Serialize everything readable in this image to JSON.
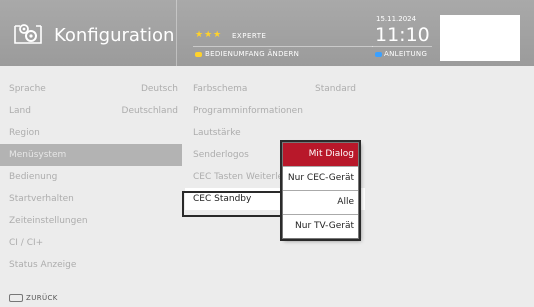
{
  "header": {
    "title": "Konfiguration",
    "stars": "★★★",
    "level": "Experte",
    "action_change": "Bedienumfang ändern",
    "date": "15.11.2024",
    "time": "11:10",
    "action_help": "Anleitung"
  },
  "menu": {
    "items": [
      {
        "label": "Sprache",
        "value": "Deutsch"
      },
      {
        "label": "Land",
        "value": "Deutschland"
      },
      {
        "label": "Region",
        "value": ""
      },
      {
        "label": "Menüsystem",
        "value": ""
      },
      {
        "label": "Bedienung",
        "value": ""
      },
      {
        "label": "Startverhalten",
        "value": ""
      },
      {
        "label": "Zeiteinstellungen",
        "value": ""
      },
      {
        "label": "CI / CI+",
        "value": ""
      },
      {
        "label": "Status Anzeige",
        "value": ""
      }
    ],
    "active_index": 3
  },
  "submenu": {
    "items": [
      {
        "label": "Farbschema",
        "value": "Standard"
      },
      {
        "label": "Programminformationen",
        "value": ""
      },
      {
        "label": "Lautstärke",
        "value": ""
      },
      {
        "label": "Senderlogos",
        "value": ""
      },
      {
        "label": "CEC Tasten Weiterle",
        "value": ""
      },
      {
        "label": "CEC Standby",
        "value": ""
      }
    ],
    "focused_index": 5
  },
  "popup": {
    "options": [
      "Mit Dialog",
      "Nur CEC-Gerät",
      "Alle",
      "Nur TV-Gerät"
    ],
    "selected_index": 0
  },
  "footer": {
    "back_label": "Zurück"
  },
  "colors": {
    "selected": "#b8182a",
    "yellow_key": "#ffd22a",
    "blue_key": "#3aa0ff"
  }
}
